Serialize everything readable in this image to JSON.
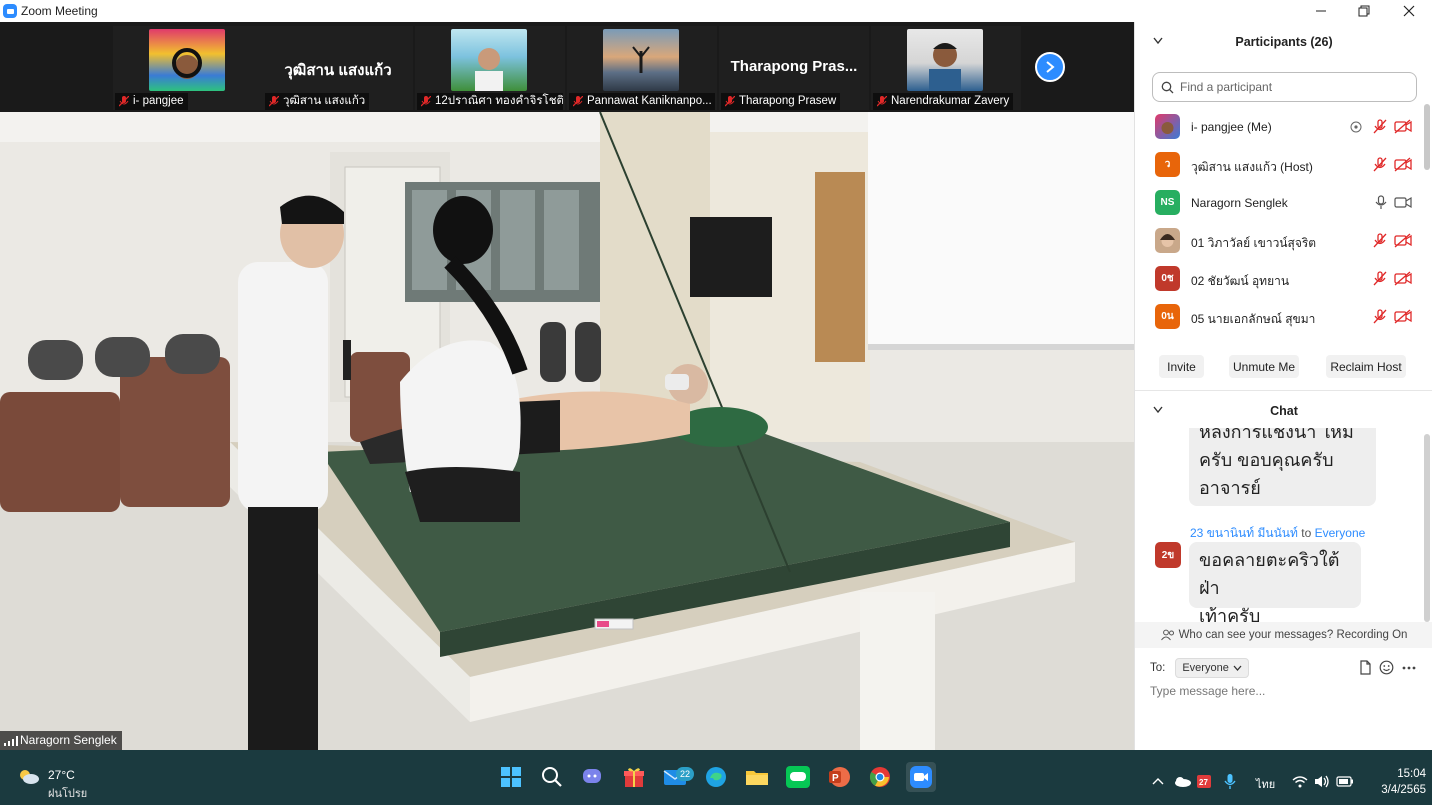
{
  "window": {
    "title": "Zoom Meeting",
    "minimize": "—",
    "restore": "❐",
    "close": "✕"
  },
  "strip": {
    "tiles": [
      {
        "name": "i- pangjee",
        "big_name": "",
        "has_photo": true
      },
      {
        "name": "วุฒิสาน แสงแก้ว",
        "big_name": "วุฒิสาน แสงแก้ว",
        "has_photo": false
      },
      {
        "name": "12ปราณิศา ทองคำจิรโชติ",
        "big_name": "",
        "has_photo": true
      },
      {
        "name": "Pannawat Kaniknanpo...",
        "big_name": "",
        "has_photo": true
      },
      {
        "name": "Tharapong Prasew",
        "big_name": "Tharapong Pras...",
        "has_photo": false
      },
      {
        "name": "Narendrakumar Zavery",
        "big_name": "",
        "has_photo": true
      }
    ]
  },
  "main_video": {
    "speaker_name": "Naragorn Senglek"
  },
  "participants": {
    "title": "Participants (26)",
    "search_placeholder": "Find a participant",
    "list": [
      {
        "name": "i- pangjee (Me)",
        "initials": "",
        "color": "#d35400",
        "muted": true,
        "video_off": true,
        "photo": true
      },
      {
        "name": "วุฒิสาน แสงแก้ว (Host)",
        "initials": "ว",
        "color": "#e8650a",
        "muted": true,
        "video_off": true,
        "photo": false
      },
      {
        "name": "Naragorn Senglek",
        "initials": "NS",
        "color": "#27ae60",
        "muted": false,
        "video_off": false,
        "photo": false
      },
      {
        "name": "01 วิภาวัลย์ เขาวน์สุจริต",
        "initials": "",
        "color": "#8e6e53",
        "muted": true,
        "video_off": true,
        "photo": true
      },
      {
        "name": "02 ชัยวัฒน์ อุทยาน",
        "initials": "0ช",
        "color": "#c0392b",
        "muted": true,
        "video_off": true,
        "photo": false
      },
      {
        "name": "05 นายเอกลักษณ์ สุขมา",
        "initials": "0น",
        "color": "#e8650a",
        "muted": true,
        "video_off": true,
        "photo": false
      }
    ],
    "buttons": {
      "invite": "Invite",
      "unmute": "Unmute Me",
      "reclaim": "Reclaim Host"
    }
  },
  "chat": {
    "title": "Chat",
    "messages": [
      {
        "text_line1": "หลังการแช่งน้ำ ใหม่",
        "text_line2": "ครับ ขอบคุณครับ",
        "text_line3": "อาจารย์"
      },
      {
        "sender": "23 ขนานินท์ มีนนันท์",
        "to_label": "to",
        "recipient": "Everyone",
        "avatar": "2ข",
        "text_line1": "ขอคลายตะคริวใต้ฝ่า",
        "text_line2": "เท้าครับ"
      }
    ],
    "notice": "Who can see your messages? Recording On",
    "to_label": "To:",
    "to_value": "Everyone",
    "input_placeholder": "Type message here..."
  },
  "taskbar": {
    "temperature": "27°C",
    "weather_desc": "ฝนโปรย",
    "mail_badge": "22",
    "language": "ไทย",
    "time": "15:04",
    "date": "3/4/2565"
  }
}
